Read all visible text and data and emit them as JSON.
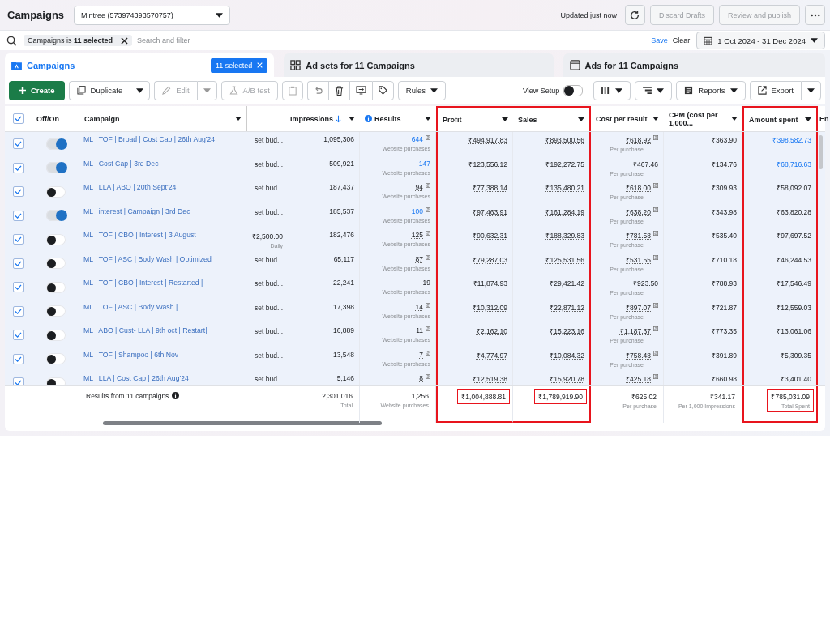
{
  "header": {
    "title": "Campaigns",
    "account": "Mintree (573974393570757)",
    "updated": "Updated just now",
    "buttons": [
      {
        "label": "Discard Drafts",
        "disabled": true
      },
      {
        "label": "Review and publish",
        "disabled": true
      }
    ]
  },
  "filter": {
    "chip": "Campaigns is **11 selected**",
    "placeholder": "Search and filter",
    "save": "Save",
    "clear": "Clear",
    "date_range": "1 Oct 2024 - 31 Dec 2024"
  },
  "tabs": [
    {
      "label": "Campaigns",
      "selected": true,
      "badge": "11 selected"
    },
    {
      "label": "Ad sets for 11 Campaigns",
      "selected": false
    },
    {
      "label": "Ads for 11 Campaigns",
      "selected": false
    }
  ],
  "toolbar": {
    "create": "Create",
    "duplicate": "Duplicate",
    "edit": "Edit",
    "edit_disabled": true,
    "ab_test": "A/B test",
    "ab_disabled": true,
    "rules": "Rules",
    "view_setup": "View Setup",
    "view_setup_on": false,
    "reports": "Reports",
    "export": "Export"
  },
  "columns": [
    {
      "kind": "check",
      "checked": true
    },
    {
      "kind": "toggle",
      "label": "Off/On"
    },
    {
      "kind": "campaign",
      "label": "Campaign"
    },
    {
      "kind": "budget"
    },
    {
      "kind": "impressions",
      "label": "Impressions",
      "sorted": true
    },
    {
      "kind": "results",
      "label": "Results",
      "info": true
    },
    {
      "kind": "profit",
      "label": "Profit",
      "highlighted": true
    },
    {
      "kind": "sales",
      "label": "Sales",
      "highlighted": true
    },
    {
      "kind": "cpr",
      "label": "Cost per result"
    },
    {
      "kind": "cpm",
      "label": "CPM (cost per 1,000..."
    },
    {
      "kind": "amount",
      "label": "Amount spent",
      "highlighted": true
    },
    {
      "kind": "cut",
      "label": "En"
    }
  ],
  "rows": [
    {
      "checked": true,
      "on": true,
      "campaign": "ML | TOF | Broad | Cost Cap | 26th Aug'24",
      "budget": "set bud...",
      "impressions": "1,095,306",
      "results": "644",
      "results_link": true,
      "results_sub": "Website purchases",
      "attributed": true,
      "profit": "₹494,917.83",
      "sales": "₹893,500.56",
      "cpr": "₹618.92",
      "cpr_sub": "Per purchase",
      "cpm": "₹363.90",
      "amount": "₹398,582.73",
      "amount_link": true
    },
    {
      "checked": true,
      "on": true,
      "campaign": "ML | Cost Cap | 3rd Dec",
      "budget": "set bud...",
      "impressions": "509,921",
      "results": "147",
      "results_link": true,
      "results_sub": "Website purchases",
      "attributed": false,
      "profit": "₹123,556.12",
      "sales": "₹192,272.75",
      "cpr": "₹467.46",
      "cpr_sub": "Per purchase",
      "cpm": "₹134.76",
      "amount": "₹68,716.63",
      "amount_link": true
    },
    {
      "checked": true,
      "on": false,
      "campaign": "ML | LLA | ABO | 20th Sept'24",
      "budget": "set bud...",
      "impressions": "187,437",
      "results": "94",
      "results_link": false,
      "results_sub": "Website purchases",
      "attributed": true,
      "profit": "₹77,388.14",
      "sales": "₹135,480.21",
      "cpr": "₹618.00",
      "cpr_sub": "Per purchase",
      "cpm": "₹309.93",
      "amount": "₹58,092.07",
      "amount_link": false
    },
    {
      "checked": true,
      "on": true,
      "campaign": "ML | interest | Campaign | 3rd Dec",
      "budget": "set bud...",
      "impressions": "185,537",
      "results": "100",
      "results_link": true,
      "results_sub": "Website purchases",
      "attributed": true,
      "profit": "₹97,463.91",
      "sales": "₹161,284.19",
      "cpr": "₹638.20",
      "cpr_sub": "Per purchase",
      "cpm": "₹343.98",
      "amount": "₹63,820.28",
      "amount_link": false
    },
    {
      "checked": true,
      "on": false,
      "campaign": "ML | TOF | CBO | Interest | 3 August",
      "budget": "₹2,500.00",
      "budget_sub": "Daily",
      "impressions": "182,476",
      "results": "125",
      "results_link": false,
      "results_sub": "Website purchases",
      "attributed": true,
      "profit": "₹90,632.31",
      "sales": "₹188,329.83",
      "cpr": "₹781.58",
      "cpr_sub": "Per purchase",
      "cpm": "₹535.40",
      "amount": "₹97,697.52",
      "amount_link": false
    },
    {
      "checked": true,
      "on": false,
      "campaign": "ML | TOF | ASC | Body Wash | Optimized",
      "budget": "set bud...",
      "impressions": "65,117",
      "results": "87",
      "results_link": false,
      "results_sub": "Website purchases",
      "attributed": true,
      "profit": "₹79,287.03",
      "sales": "₹125,531.56",
      "cpr": "₹531.55",
      "cpr_sub": "Per purchase",
      "cpm": "₹710.18",
      "amount": "₹46,244.53",
      "amount_link": false
    },
    {
      "checked": true,
      "on": false,
      "campaign": "ML | TOF | CBO | Interest | Restarted |",
      "budget": "set bud...",
      "impressions": "22,241",
      "results": "19",
      "results_link": false,
      "results_sub": "Website purchases",
      "attributed": false,
      "profit": "₹11,874.93",
      "sales": "₹29,421.42",
      "cpr": "₹923.50",
      "cpr_sub": "Per purchase",
      "cpm": "₹788.93",
      "amount": "₹17,546.49",
      "amount_link": false
    },
    {
      "checked": true,
      "on": false,
      "campaign": "ML | TOF | ASC | Body Wash |",
      "budget": "set bud...",
      "impressions": "17,398",
      "results": "14",
      "results_link": false,
      "results_sub": "Website purchases",
      "attributed": true,
      "profit": "₹10,312.09",
      "sales": "₹22,871.12",
      "cpr": "₹897.07",
      "cpr_sub": "Per purchase",
      "cpm": "₹721.87",
      "amount": "₹12,559.03",
      "amount_link": false
    },
    {
      "checked": true,
      "on": false,
      "campaign": "ML | ABO | Cust- LLA | 9th oct | Restart|",
      "budget": "set bud...",
      "impressions": "16,889",
      "results": "11",
      "results_link": false,
      "results_sub": "Website purchases",
      "attributed": true,
      "profit": "₹2,162.10",
      "sales": "₹15,223.16",
      "cpr": "₹1,187.37",
      "cpr_sub": "Per purchase",
      "cpm": "₹773.35",
      "amount": "₹13,061.06",
      "amount_link": false
    },
    {
      "checked": true,
      "on": false,
      "campaign": "ML | TOF | Shampoo | 6th Nov",
      "budget": "set bud...",
      "impressions": "13,548",
      "results": "7",
      "results_link": false,
      "results_sub": "Website purchases",
      "attributed": true,
      "profit": "₹4,774.97",
      "sales": "₹10,084.32",
      "cpr": "₹758.48",
      "cpr_sub": "Per purchase",
      "cpm": "₹391.89",
      "amount": "₹5,309.35",
      "amount_link": false
    },
    {
      "checked": true,
      "on": false,
      "campaign": "ML | LLA | Cost Cap | 26th Aug'24",
      "budget": "set bud...",
      "impressions": "5,146",
      "results": "8",
      "results_link": false,
      "attributed": true,
      "profit": "₹12,519.38",
      "sales": "₹15,920.78",
      "cpr": "₹425.18",
      "cpm": "₹660.98",
      "amount": "₹3,401.40",
      "amount_link": false
    }
  ],
  "footer": [
    {
      "kind": "campaign",
      "value": "Results from 11 campaigns",
      "info": true
    },
    {
      "kind": "impressions",
      "value": "2,301,016",
      "sub": "Total",
      "highlighted": false
    },
    {
      "kind": "results",
      "value": "1,256",
      "sub": "Website purchases",
      "highlighted": false
    },
    {
      "kind": "profit",
      "value": "₹1,004,888.81",
      "highlighted": true
    },
    {
      "kind": "sales",
      "value": "₹1,789,919.90",
      "highlighted": true
    },
    {
      "kind": "cpr",
      "value": "₹625.02",
      "sub": "Per purchase",
      "highlighted": false
    },
    {
      "kind": "cpm",
      "value": "₹341.17",
      "sub": "Per 1,000 Impressions",
      "highlighted": false
    },
    {
      "kind": "amount",
      "value": "₹785,031.09",
      "sub": "Total Spent",
      "highlighted": true
    }
  ]
}
